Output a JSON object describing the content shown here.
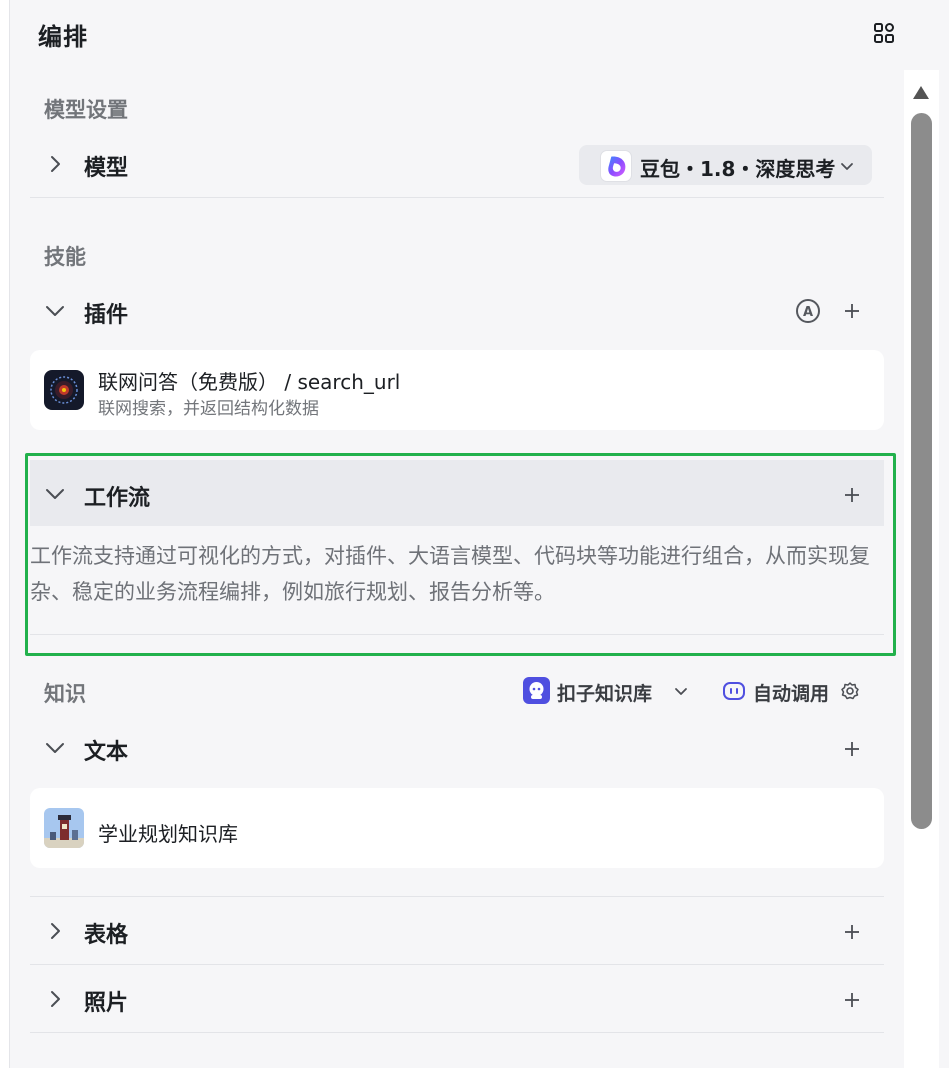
{
  "header": {
    "title": "编排"
  },
  "model_settings": {
    "label": "模型设置",
    "row_title": "模型",
    "model_name": "豆包・1.8・深度思考"
  },
  "skills": {
    "label": "技能",
    "plugins": {
      "title": "插件",
      "auto_badge": "A",
      "items": [
        {
          "name": "联网问答（免费版） / search_url",
          "desc": "联网搜索，并返回结构化数据"
        }
      ]
    },
    "workflow": {
      "title": "工作流",
      "desc": "工作流支持通过可视化的方式，对插件、大语言模型、代码块等功能进行组合，从而实现复杂、稳定的业务流程编排，例如旅行规划、报告分析等。",
      "highlight_color": "#22b14c"
    }
  },
  "knowledge": {
    "label": "知识",
    "kb_selector": "扣子知识库",
    "auto_call": "自动调用",
    "text": {
      "title": "文本",
      "items": [
        {
          "name": "学业规划知识库"
        }
      ]
    },
    "table": {
      "title": "表格"
    },
    "photo": {
      "title": "照片"
    }
  },
  "icons": [
    "layout-grid-icon",
    "chevron-right-icon",
    "chevron-down-icon",
    "plus-icon",
    "gear-icon",
    "scroll-up-icon"
  ]
}
